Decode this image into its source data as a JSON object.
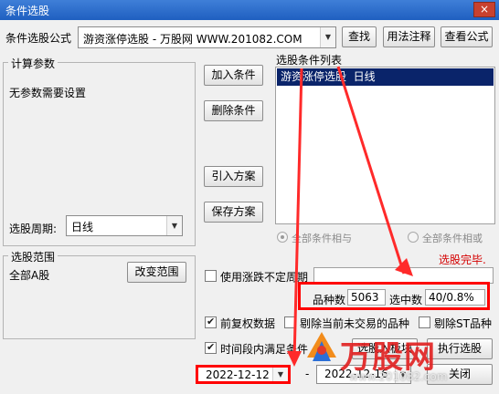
{
  "window": {
    "title": "条件选股",
    "close_symbol": "×"
  },
  "formula": {
    "label": "条件选股公式",
    "value": "游资涨停选股 - 万股网 WWW.201082.COM"
  },
  "top_buttons": {
    "find": "查找",
    "usage": "用法注释",
    "view": "查看公式"
  },
  "params": {
    "group_label": "计算参数",
    "text": "无参数需要设置",
    "period_label": "选股周期:",
    "period_value": "日线"
  },
  "conditions": {
    "list_label": "选股条件列表",
    "items": [
      "游资涨停选股  日线"
    ],
    "add": "加入条件",
    "remove": "删除条件",
    "import": "引入方案",
    "save": "保存方案",
    "radio_and": "全部条件相与",
    "radio_or": "全部条件相或"
  },
  "status": {
    "text": "选股完毕.",
    "color": "#d40000"
  },
  "range": {
    "group_label": "选股范围",
    "value": "全部A股",
    "change": "改变范围"
  },
  "unstable": {
    "label": "使用涨跌不定周期",
    "value": ""
  },
  "stats": {
    "count_label": "品种数",
    "count_value": "5063",
    "hit_label": "选中数",
    "hit_value": "40/0.8%"
  },
  "options": {
    "adjust": "前复权数据",
    "exclude_untraded": "剔除当前未交易的品种",
    "exclude_st": "剔除ST品种",
    "period_condition": "时间段内满足条件"
  },
  "dates": {
    "start": "2022-12-12",
    "end": "2022-12-16"
  },
  "actions": {
    "to_block": "选股入板块",
    "run": "执行选股",
    "close": "关闭"
  },
  "watermark": {
    "brand": "万股网",
    "url": "www.201082.com"
  },
  "accent": {
    "highlight": "#ff0000",
    "list_selected": "#0a246a"
  }
}
